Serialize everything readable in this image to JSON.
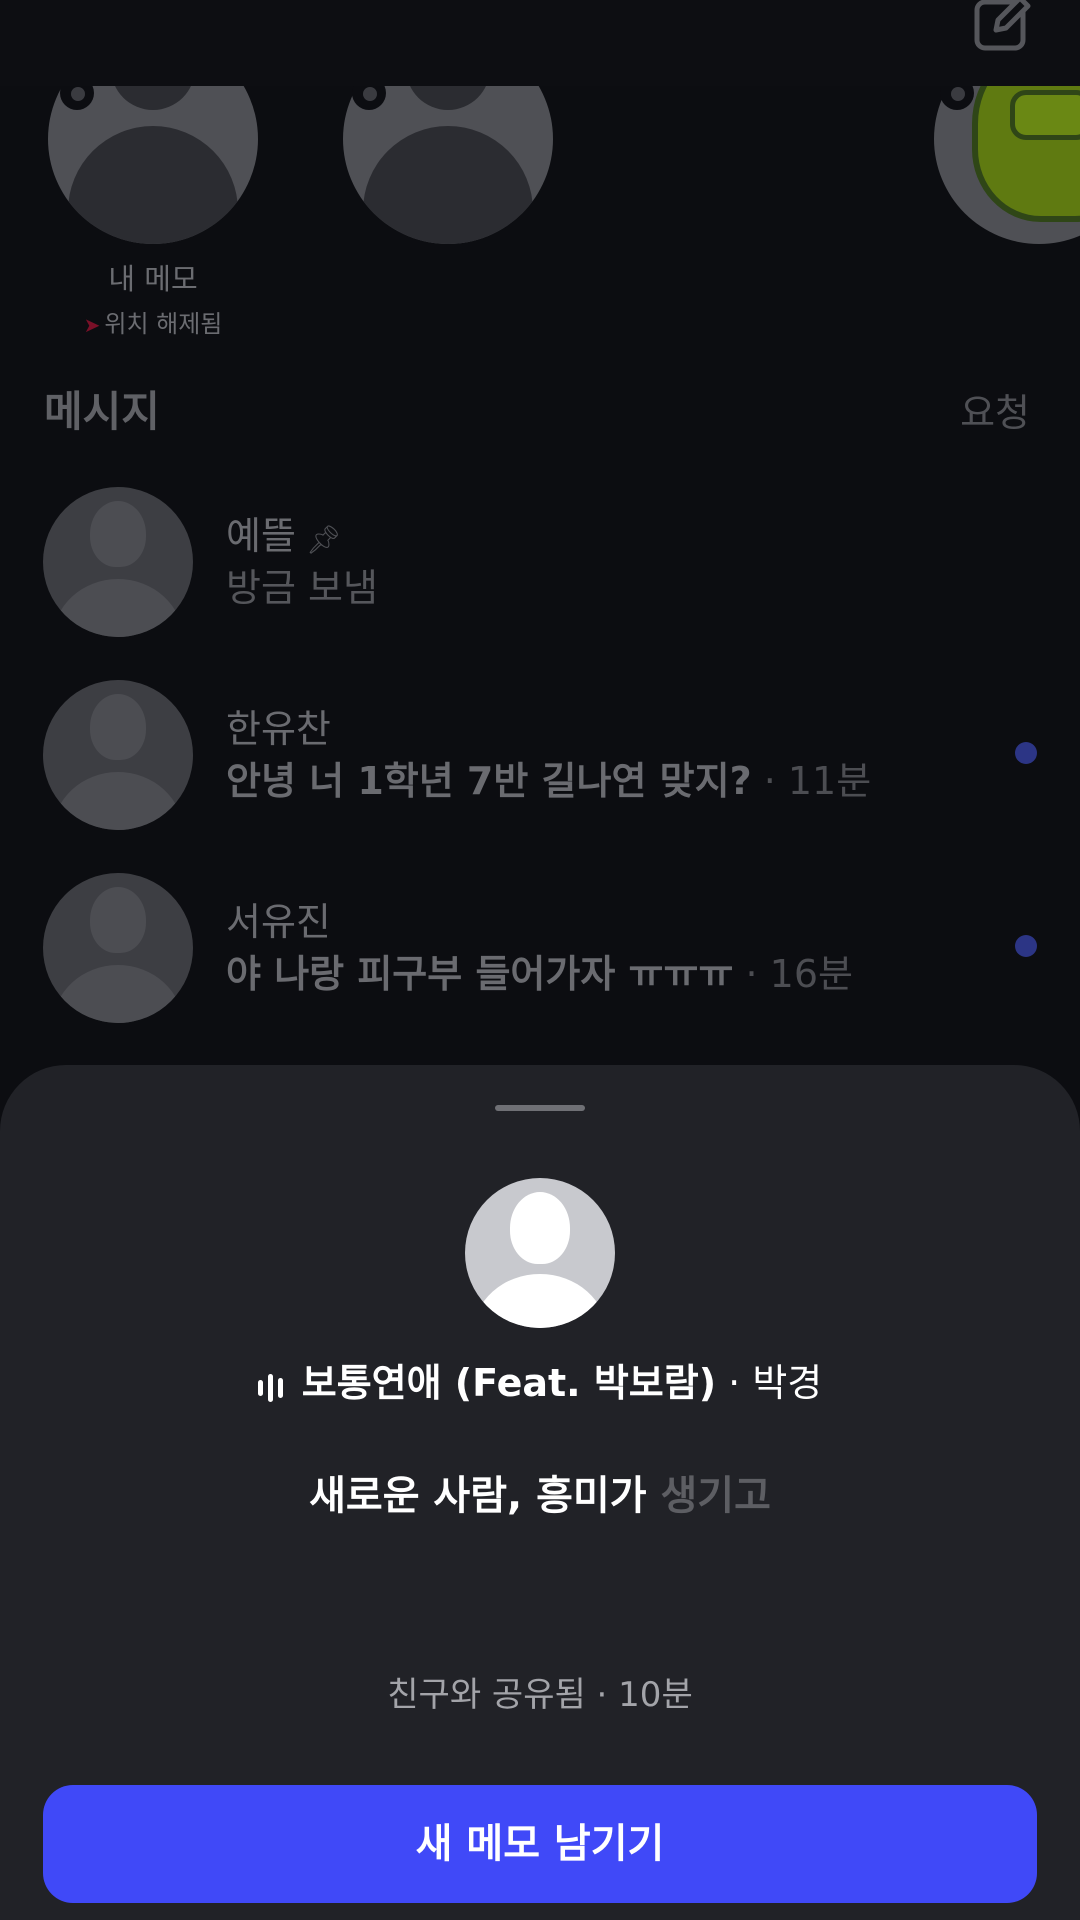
{
  "notes": {
    "my_memo_label": "내 메모",
    "location_status": "위치 해제됨"
  },
  "messages": {
    "section_title": "메시지",
    "requests_label": "요청",
    "threads": [
      {
        "name": "예뜰",
        "preview": "방금 보냄",
        "time": "",
        "pinned": true,
        "unread": false
      },
      {
        "name": "한유찬",
        "preview": "안녕 너 1학년 7반 길나연 맞지?",
        "time": " · 11분",
        "pinned": false,
        "unread": true
      },
      {
        "name": "서유진",
        "preview": "야 나랑 피구부 들어가자 ㅠㅠㅠ",
        "time": " · 16분",
        "pinned": false,
        "unread": true
      }
    ]
  },
  "sheet": {
    "song_title": "보통연애 (Feat. 박보람)",
    "song_artist": " · 박경",
    "lyric_lit": "새로운 사람, 흥미가",
    "lyric_dim": " 생기고",
    "shared_status": "친구와 공유됨 · 10분",
    "cta_label": "새 메모 남기기"
  },
  "colors": {
    "accent": "#4049f8",
    "sheet_bg": "#212227",
    "unread_dot": "#2c3585"
  },
  "icons": [
    "compose-icon",
    "pin-icon",
    "location-off-icon",
    "audio-bars-icon"
  ]
}
